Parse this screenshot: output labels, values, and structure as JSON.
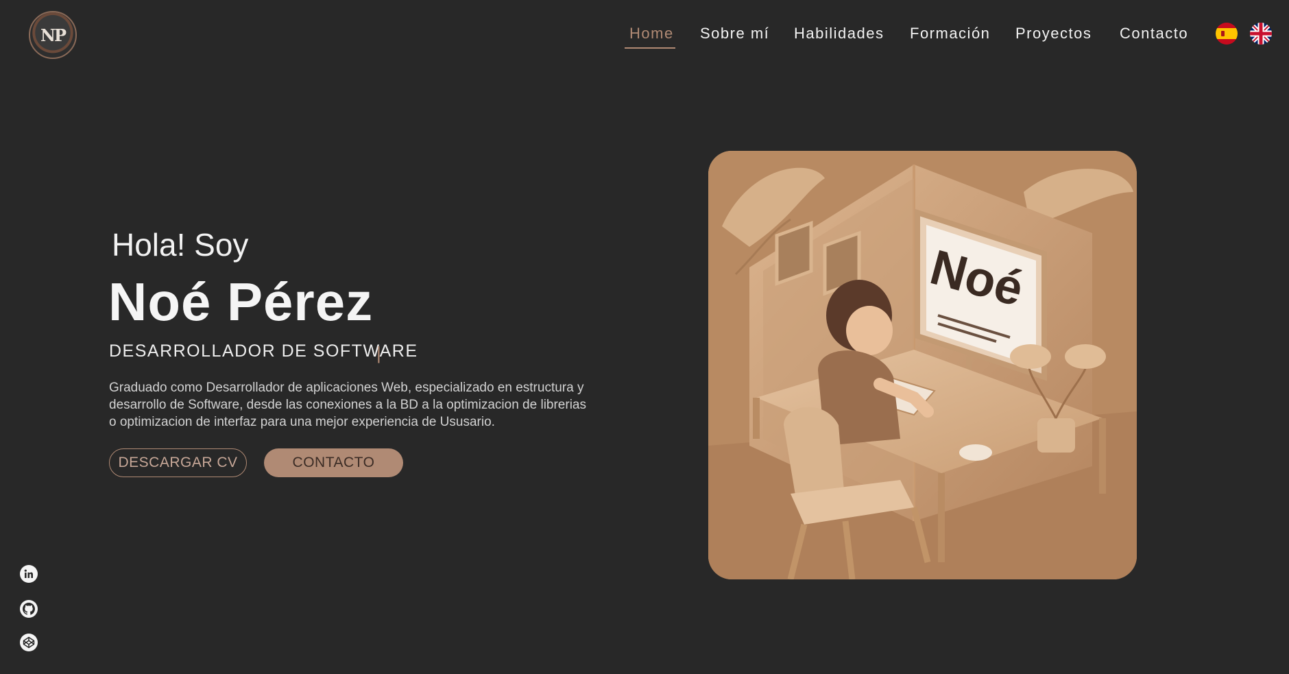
{
  "nav": {
    "logo_text": "NP",
    "items": [
      {
        "label": "Home",
        "active": true
      },
      {
        "label": "Sobre mí",
        "active": false
      },
      {
        "label": "Habilidades",
        "active": false
      },
      {
        "label": "Formación",
        "active": false
      },
      {
        "label": "Proyectos",
        "active": false
      },
      {
        "label": "Contacto",
        "active": false
      }
    ],
    "languages": [
      "spain-flag-icon",
      "uk-flag-icon"
    ]
  },
  "hero": {
    "greeting": "Hola! Soy",
    "name": "Noé Pérez",
    "role": "DESARROLLADOR DE SOFTWARE",
    "caret": "|",
    "description": "Graduado como Desarrollador de aplicaciones Web, especializado en estructura y desarrollo de Software, desde las conexiones a la BD a la optimizacion de librerias o optimizacion de interfaz para una mejor experiencia de Ususario.",
    "buttons": {
      "cv": "DESCARGAR CV",
      "contact": "CONTACTO"
    },
    "illustration_text": "Noé"
  },
  "social": [
    "linkedin-icon",
    "github-icon",
    "codepen-icon"
  ],
  "colors": {
    "background": "#282828",
    "accent": "#b08a74",
    "text": "#f2f2f2"
  }
}
